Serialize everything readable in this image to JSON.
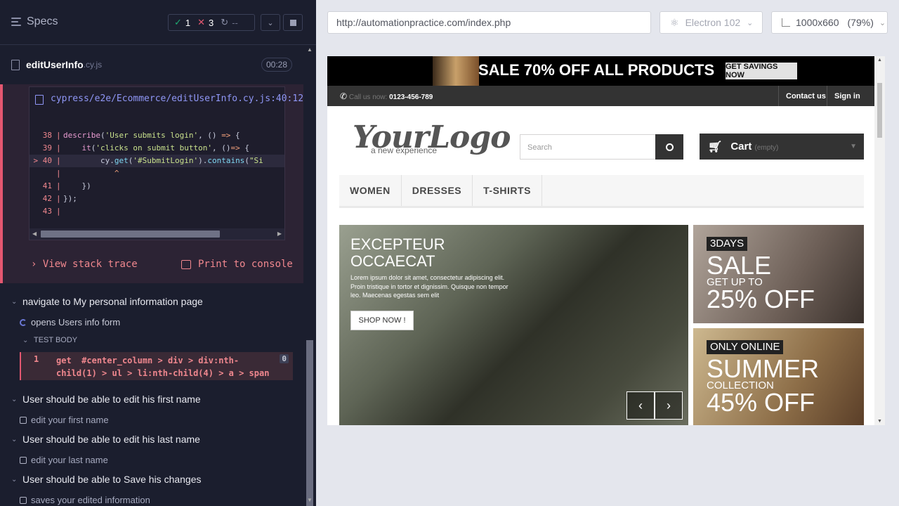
{
  "reporter": {
    "specs_label": "Specs",
    "passed": "1",
    "failed": "3",
    "pending": "--",
    "file_name": "editUserInfo",
    "file_ext": ".cy.js",
    "duration": "00:28"
  },
  "error": {
    "file_path": "cypress/e2e/Ecommerce/editUserInfo.cy.js:40:12",
    "code_lines": [
      {
        "num": "38",
        "parts": [
          [
            "kw",
            "describe"
          ],
          [
            "ctext",
            "("
          ],
          [
            "str",
            "'User submits login'"
          ],
          [
            "ctext",
            ", () "
          ],
          [
            "ar",
            "=>"
          ],
          [
            "ctext",
            " {"
          ]
        ]
      },
      {
        "num": "39",
        "parts": [
          [
            "ctext",
            "    "
          ],
          [
            "kw",
            "it"
          ],
          [
            "ctext",
            "("
          ],
          [
            "str",
            "'clicks on submit button'"
          ],
          [
            "ctext",
            ", ()"
          ],
          [
            "ar",
            "=>"
          ],
          [
            "ctext",
            " {"
          ]
        ]
      },
      {
        "num": "> 40",
        "parts": [
          [
            "ctext",
            "        cy."
          ],
          [
            "fn",
            "get"
          ],
          [
            "ctext",
            "("
          ],
          [
            "str",
            "'#SubmitLogin'"
          ],
          [
            "ctext",
            ")."
          ],
          [
            "fn",
            "contains"
          ],
          [
            "ctext",
            "("
          ],
          [
            "str",
            "\"Si"
          ]
        ]
      },
      {
        "num": "",
        "parts": [
          [
            "ctext",
            "           "
          ],
          [
            "ar",
            "^"
          ]
        ]
      },
      {
        "num": "41",
        "parts": [
          [
            "ctext",
            "    })"
          ]
        ]
      },
      {
        "num": "42",
        "parts": [
          [
            "ctext",
            "});"
          ]
        ]
      },
      {
        "num": "43",
        "parts": [
          [
            "ctext",
            ""
          ]
        ]
      }
    ],
    "view_stack": "View stack trace",
    "print_console": "Print to console"
  },
  "tests": {
    "hook1": "navigate to My personal information page",
    "test1": "opens Users info form",
    "test_body": "TEST BODY",
    "cmd_num": "1",
    "cmd_name": "get",
    "cmd_selector": "#center_column > div > div:nth-child(1) > ul > li:nth-child(4) > a > span",
    "cmd_count": "0",
    "hook2": "User should be able to edit his first name",
    "test2": "edit your first name",
    "hook3": "User should be able to edit his last name",
    "test3": "edit your last name",
    "hook4": "User should be able to Save his changes",
    "test4": "saves your edited information"
  },
  "toolbar": {
    "url": "http://automationpractice.com/index.php",
    "browser": "Electron 102",
    "viewport": "1000x660",
    "scale": "(79%)"
  },
  "aut": {
    "banner_text": "SALE 70% OFF ALL PRODUCTS",
    "banner_btn": "GET SAVINGS NOW",
    "call_label": "Call us now:",
    "phone": "0123-456-789",
    "contact": "Contact us",
    "signin": "Sign in",
    "logo": "YourLogo",
    "tagline": "a new experience",
    "search_placeholder": "Search",
    "cart": "Cart",
    "cart_empty": "(empty)",
    "menu": [
      "WOMEN",
      "DRESSES",
      "T-SHIRTS"
    ],
    "slide_title_1": "EXCEPTEUR",
    "slide_title_2": "OCCAECAT",
    "slide_text": "Lorem ipsum dolor sit amet, consectetur adipiscing elit. Proin tristique in tortor et dignissim. Quisque non tempor leo. Maecenas egestas sem elit",
    "shop_now": "SHOP NOW !",
    "promo1_tag": "3DAYS",
    "promo1_big": "SALE",
    "promo1_small": "GET UP TO",
    "promo1_pct": "25% OFF",
    "promo2_tag": "ONLY ONLINE",
    "promo2_big": "SUMMER",
    "promo2_small": "COLLECTION",
    "promo2_pct": "45% OFF"
  },
  "colors": {
    "passed": "#1fa971",
    "failed": "#e45770",
    "accent": "#6470f3"
  }
}
